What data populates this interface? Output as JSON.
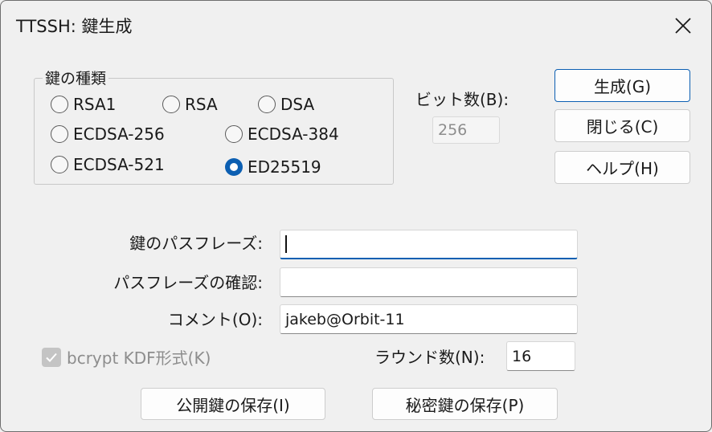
{
  "window": {
    "title": "TTSSH: 鍵生成"
  },
  "key_type": {
    "legend": "鍵の種類",
    "options": [
      {
        "label": "RSA1",
        "checked": false
      },
      {
        "label": "RSA",
        "checked": false
      },
      {
        "label": "DSA",
        "checked": false
      },
      {
        "label": "ECDSA-256",
        "checked": false
      },
      {
        "label": "ECDSA-384",
        "checked": false
      },
      {
        "label": "ECDSA-521",
        "checked": false
      },
      {
        "label": "ED25519",
        "checked": true
      }
    ]
  },
  "bits": {
    "label": "ビット数(B):",
    "value": "256"
  },
  "buttons": {
    "generate": "生成(G)",
    "close": "閉じる(C)",
    "help": "ヘルプ(H)",
    "save_public": "公開鍵の保存(I)",
    "save_private": "秘密鍵の保存(P)"
  },
  "form": {
    "passphrase_label": "鍵のパスフレーズ:",
    "passphrase_value": "",
    "confirm_label": "パスフレーズの確認:",
    "confirm_value": "",
    "comment_label": "コメント(O):",
    "comment_value": "jakeb@Orbit-11",
    "bcrypt_label": "bcrypt KDF形式(K)",
    "bcrypt_checked": true,
    "rounds_label": "ラウンド数(N):",
    "rounds_value": "16"
  },
  "icons": {
    "close": "close-icon",
    "check": "checkmark-icon"
  },
  "colors": {
    "accent": "#0c5fb2",
    "background": "#f0f0f0"
  }
}
